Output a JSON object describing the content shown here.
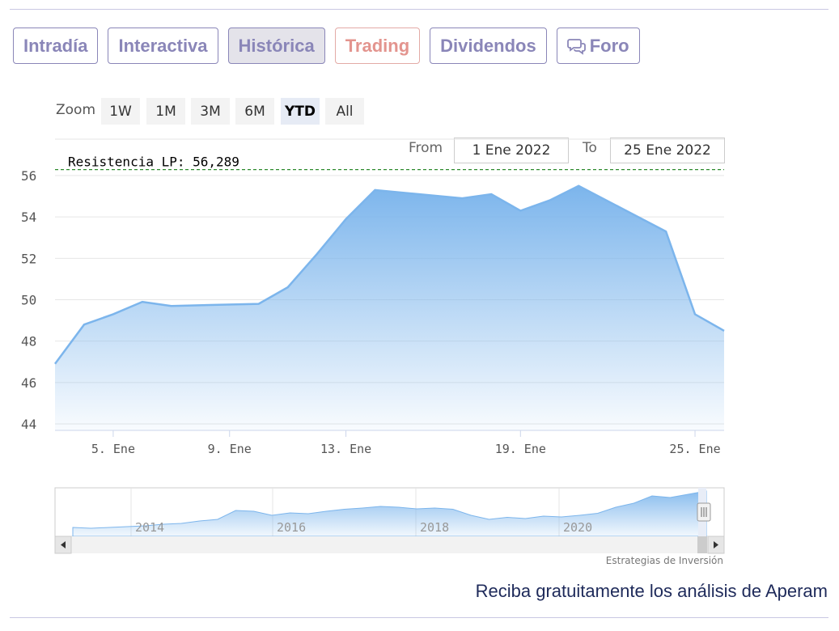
{
  "tabs": [
    {
      "label": "Intradía",
      "active": false
    },
    {
      "label": "Interactiva",
      "active": false
    },
    {
      "label": "Histórica",
      "active": true
    },
    {
      "label": "Trading",
      "active": false
    },
    {
      "label": "Dividendos",
      "active": false
    },
    {
      "label": "Foro",
      "active": false,
      "icon": "chat-bubbles-icon"
    }
  ],
  "zoom": {
    "label": "Zoom",
    "buttons": [
      "1W",
      "1M",
      "3M",
      "6M",
      "YTD",
      "All"
    ],
    "selected": "YTD"
  },
  "range": {
    "from_label": "From",
    "from_value": "1 Ene 2022",
    "to_label": "To",
    "to_value": "25 Ene 2022"
  },
  "chart_data": {
    "type": "area",
    "title": "",
    "xlabel": "",
    "ylabel": "",
    "ylim": [
      44,
      56
    ],
    "yticks": [
      44,
      46,
      48,
      50,
      52,
      54,
      56
    ],
    "xlim": [
      "2022-01-03",
      "2022-01-26"
    ],
    "xticks": [
      {
        "date": "2022-01-05",
        "label": "5. Ene"
      },
      {
        "date": "2022-01-09",
        "label": "9. Ene"
      },
      {
        "date": "2022-01-13",
        "label": "13. Ene"
      },
      {
        "date": "2022-01-19",
        "label": "19. Ene"
      },
      {
        "date": "2022-01-25",
        "label": "25. Ene"
      }
    ],
    "grid": true,
    "series": [
      {
        "color": "#7cb5ec",
        "points": [
          {
            "x": "2022-01-03",
            "y": 46.9
          },
          {
            "x": "2022-01-04",
            "y": 48.8
          },
          {
            "x": "2022-01-05",
            "y": 49.3
          },
          {
            "x": "2022-01-06",
            "y": 49.9
          },
          {
            "x": "2022-01-07",
            "y": 49.7
          },
          {
            "x": "2022-01-10",
            "y": 49.8
          },
          {
            "x": "2022-01-11",
            "y": 50.6
          },
          {
            "x": "2022-01-12",
            "y": 52.2
          },
          {
            "x": "2022-01-13",
            "y": 53.9
          },
          {
            "x": "2022-01-14",
            "y": 55.3
          },
          {
            "x": "2022-01-17",
            "y": 54.9
          },
          {
            "x": "2022-01-18",
            "y": 55.1
          },
          {
            "x": "2022-01-19",
            "y": 54.3
          },
          {
            "x": "2022-01-20",
            "y": 54.8
          },
          {
            "x": "2022-01-21",
            "y": 55.5
          },
          {
            "x": "2022-01-24",
            "y": 53.3
          },
          {
            "x": "2022-01-25",
            "y": 49.3
          },
          {
            "x": "2022-01-26",
            "y": 48.5
          }
        ]
      }
    ],
    "annotations": [
      {
        "type": "hline",
        "y": 56.289,
        "label": "Resistencia LP: 56,289",
        "color": "#2e8b2e",
        "style": "dashed"
      }
    ],
    "navigator": {
      "year_labels": [
        "2014",
        "2016",
        "2018",
        "2020"
      ],
      "color": "#7cb5ec"
    }
  },
  "caption": "Estrategias de Inversión",
  "cta": "Reciba gratuitamente los análisis de Aperam"
}
